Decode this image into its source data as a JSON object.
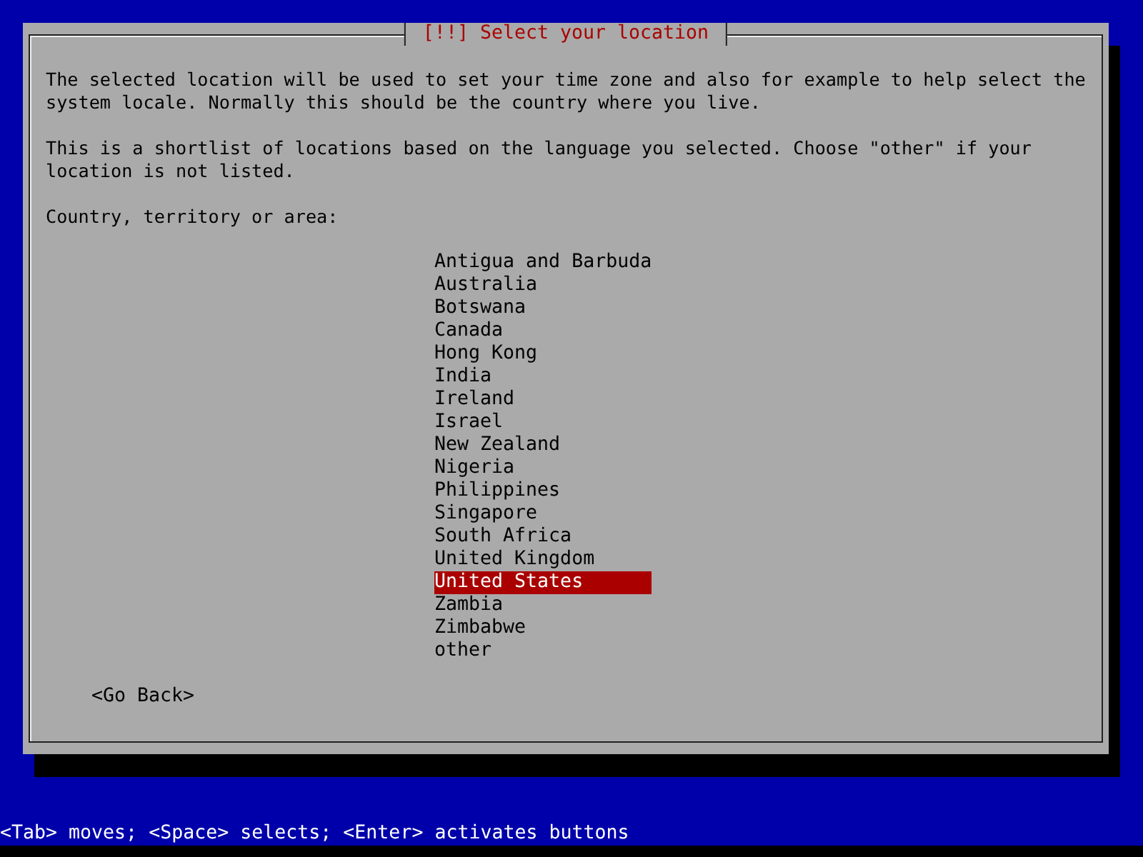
{
  "dialog": {
    "title": "[!!] Select your location",
    "paragraphs": [
      "The selected location will be used to set your time zone and also for example to help select the system locale. Normally this should be the country where you live.",
      "This is a shortlist of locations based on the language you selected. Choose \"other\" if your location is not listed."
    ],
    "list_label": "Country, territory or area:",
    "items": [
      {
        "label": "Antigua and Barbuda",
        "selected": false
      },
      {
        "label": "Australia",
        "selected": false
      },
      {
        "label": "Botswana",
        "selected": false
      },
      {
        "label": "Canada",
        "selected": false
      },
      {
        "label": "Hong Kong",
        "selected": false
      },
      {
        "label": "India",
        "selected": false
      },
      {
        "label": "Ireland",
        "selected": false
      },
      {
        "label": "Israel",
        "selected": false
      },
      {
        "label": "New Zealand",
        "selected": false
      },
      {
        "label": "Nigeria",
        "selected": false
      },
      {
        "label": "Philippines",
        "selected": false
      },
      {
        "label": "Singapore",
        "selected": false
      },
      {
        "label": "South Africa",
        "selected": false
      },
      {
        "label": "United Kingdom",
        "selected": false
      },
      {
        "label": "United States",
        "selected": true
      },
      {
        "label": "Zambia",
        "selected": false
      },
      {
        "label": "Zimbabwe",
        "selected": false
      },
      {
        "label": "other",
        "selected": false
      }
    ],
    "back_button": "<Go Back>"
  },
  "status_bar": "<Tab> moves; <Space> selects; <Enter> activates buttons"
}
